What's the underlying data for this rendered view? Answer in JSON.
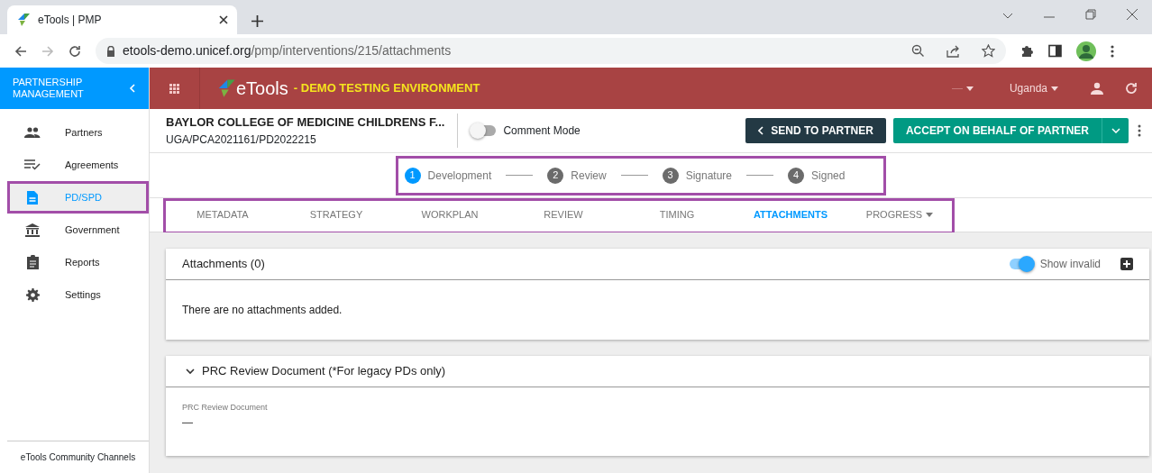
{
  "browser": {
    "tab_title": "eTools | PMP",
    "url_host": "etools-demo.unicef.org",
    "url_path": "/pmp/interventions/215/attachments"
  },
  "sidebar": {
    "title": "PARTNERSHIP MANAGEMENT",
    "items": [
      {
        "label": "Partners",
        "selected": false,
        "highlighted": false
      },
      {
        "label": "Agreements",
        "selected": false,
        "highlighted": false
      },
      {
        "label": "PD/SPD",
        "selected": true,
        "highlighted": true
      },
      {
        "label": "Government",
        "selected": false,
        "highlighted": false
      },
      {
        "label": "Reports",
        "selected": false,
        "highlighted": false
      },
      {
        "label": "Settings",
        "selected": false,
        "highlighted": false
      }
    ],
    "footer": "eTools Community Channels"
  },
  "app_header": {
    "logo_text": "eTools",
    "environment": "- DEMO TESTING ENVIRONMENT",
    "section_selector": "—",
    "country": "Uganda"
  },
  "page_header": {
    "title": "BAYLOR COLLEGE OF MEDICINE CHILDRENS F...",
    "reference": "UGA/PCA2021161/PD2022215",
    "comment_mode": {
      "label": "Comment Mode",
      "on": false
    },
    "send_button": "SEND TO PARTNER",
    "accept_button": "ACCEPT ON BEHALF OF PARTNER"
  },
  "steps": {
    "highlighted": true,
    "items": [
      {
        "number": "1",
        "label": "Development",
        "active": true
      },
      {
        "number": "2",
        "label": "Review",
        "active": false
      },
      {
        "number": "3",
        "label": "Signature",
        "active": false
      },
      {
        "number": "4",
        "label": "Signed",
        "active": false
      }
    ]
  },
  "tabs": {
    "highlighted": true,
    "items": [
      {
        "label": "METADATA",
        "selected": false,
        "dropdown": false
      },
      {
        "label": "STRATEGY",
        "selected": false,
        "dropdown": false
      },
      {
        "label": "WORKPLAN",
        "selected": false,
        "dropdown": false
      },
      {
        "label": "REVIEW",
        "selected": false,
        "dropdown": false
      },
      {
        "label": "TIMING",
        "selected": false,
        "dropdown": false
      },
      {
        "label": "ATTACHMENTS",
        "selected": true,
        "dropdown": false
      },
      {
        "label": "PROGRESS",
        "selected": false,
        "dropdown": true
      }
    ]
  },
  "attachments_card": {
    "title": "Attachments (0)",
    "show_invalid": {
      "label": "Show invalid",
      "on": true
    },
    "empty_message": "There are no attachments added."
  },
  "prc_card": {
    "title": "PRC Review Document (*For legacy PDs only)",
    "expanded": true,
    "field_label": "PRC Review Document",
    "field_value": "—"
  }
}
